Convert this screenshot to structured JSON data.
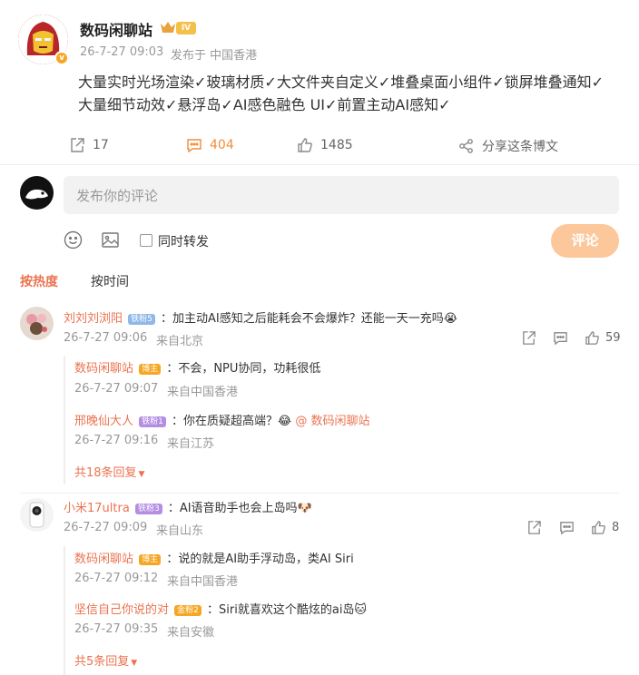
{
  "post": {
    "author": "数码闲聊站",
    "level_badge": "IV",
    "time": "26-7-27 09:03",
    "source": "发布于 中国香港",
    "text_line1": "大量实时光场渲染✓玻璃材质✓大文件夹自定义✓堆叠桌面小组件✓锁屏堆叠通知✓",
    "text_line2": "大量细节动效✓悬浮岛✓AI感色融色 UI✓前置主动AI感知✓",
    "reposts": "17",
    "comments": "404",
    "likes": "1485",
    "share_label": "分享这条博文"
  },
  "composer": {
    "placeholder": "发布你的评论",
    "emoji_icon": "smile-icon",
    "image_icon": "image-icon",
    "repost_label": "同时转发",
    "submit_label": "评论"
  },
  "sort_tabs": {
    "hot": "按热度",
    "time": "按时间"
  },
  "colors": {
    "accent": "#eb7350",
    "submit_bg": "#fbc79b",
    "comment_count": "#f08c3b"
  },
  "comments": [
    {
      "user": "刘刘刘浏阳",
      "badge": "铁粉5",
      "text": "：加主动AI感知之后能耗会不会爆炸？还能一天一充吗😭",
      "time": "26-7-27 09:06",
      "location": "来自北京",
      "likes": "59",
      "replies": [
        {
          "user": "数码闲聊站",
          "badge": "博主",
          "text": "：不会，NPU协同，功耗很低",
          "time": "26-7-27 09:07",
          "location": "来自中国香港"
        },
        {
          "user": "邢晚仙大人",
          "badge": "铁粉1",
          "text": "：你在质疑超高端？😂 ",
          "mention": "@ 数码闲聊站",
          "time": "26-7-27 09:16",
          "location": "来自江苏"
        }
      ],
      "more": "共18条回复"
    },
    {
      "user": "小米17ultra",
      "badge": "铁粉3",
      "text": "：AI语音助手也会上岛吗🐶",
      "time": "26-7-27 09:09",
      "location": "来自山东",
      "likes": "8",
      "replies": [
        {
          "user": "数码闲聊站",
          "badge": "博主",
          "text": "：说的就是AI助手浮动岛，类AI Siri",
          "time": "26-7-27 09:12",
          "location": "来自中国香港"
        },
        {
          "user": "坚信自己你说的对",
          "badge": "金粉2",
          "text": "：Siri就喜欢这个酷炫的ai岛🐱",
          "time": "26-7-27 09:35",
          "location": "来自安徽"
        }
      ],
      "more": "共5条回复"
    }
  ]
}
